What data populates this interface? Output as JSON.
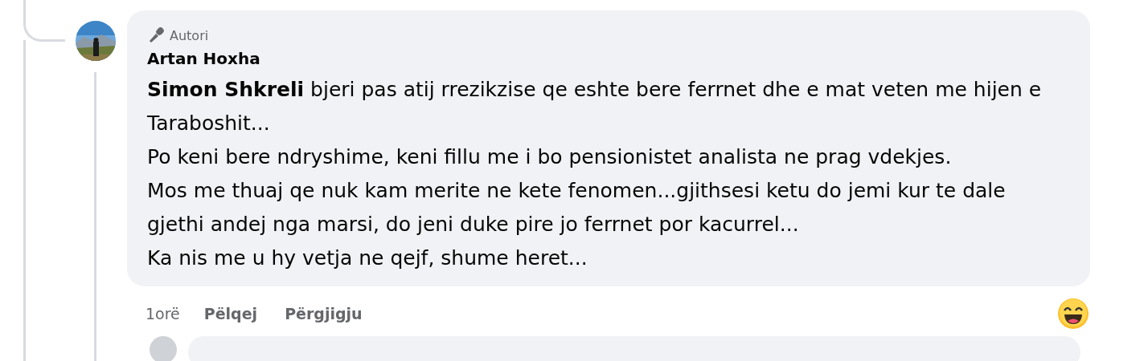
{
  "comment": {
    "badge": "Autori",
    "author": "Artan Hoxha",
    "paragraphs": [
      "**Simon Shkreli** bjeri pas atij rrezikzise qe eshte bere ferrnet dhe e mat veten me hijen e Taraboshit...",
      "Po keni bere ndryshime, keni fillu me i bo pensionistet analista ne prag vdekjes.",
      "Mos me thuaj qe nuk kam merite ne kete fenomen...gjithsesi ketu do jemi kur te dale gjethi andej nga marsi, do jeni duke pire jo ferrnet por kacurrel...",
      "Ka nis me u hy vetja ne qejf, shume heret..."
    ],
    "time": "1orë",
    "actions": [
      "Pëlqej",
      "Përgjigju"
    ],
    "reaction": {
      "kind": "haha"
    }
  }
}
